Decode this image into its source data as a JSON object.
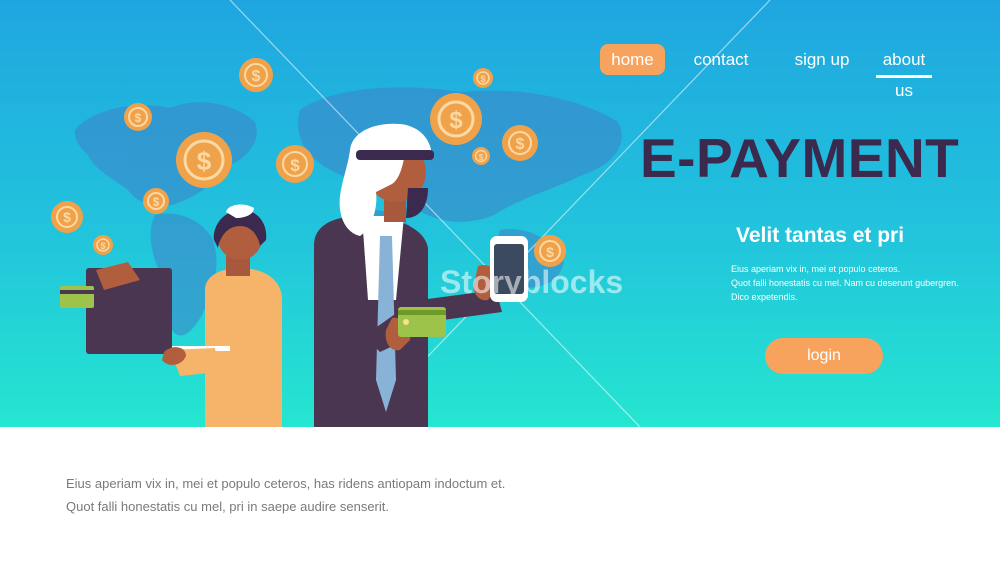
{
  "nav": {
    "items": [
      {
        "label": "home"
      },
      {
        "label": "contact"
      },
      {
        "label": "sign up"
      },
      {
        "label": "about us"
      }
    ]
  },
  "hero": {
    "title": "E-PAYMENT",
    "subtitle": "Velit tantas et pri",
    "description": [
      "Eius aperiam vix in, mei et populo ceteros.",
      "Quot falli honestatis cu mel. Nam cu deserunt gubergren.",
      "Dico expetendis."
    ],
    "login_label": "login",
    "watermark": "Storyblocks"
  },
  "body": {
    "lines": [
      "Eius aperiam vix in, mei et populo ceteros, has ridens antiopam indoctum et.",
      "Quot falli honestatis cu mel, pri in saepe audire senserit."
    ]
  },
  "icons": {
    "coin": "dollar-coin-icon",
    "card": "credit-card-icon",
    "phone": "smartphone-icon",
    "laptop": "laptop-icon"
  },
  "colors": {
    "accent": "#f7a35d",
    "title": "#3b2a4d",
    "coin": "#f0a24a",
    "card": "#9dc34a",
    "hero_top": "#1fa6e0",
    "hero_bottom": "#25e6d0"
  }
}
